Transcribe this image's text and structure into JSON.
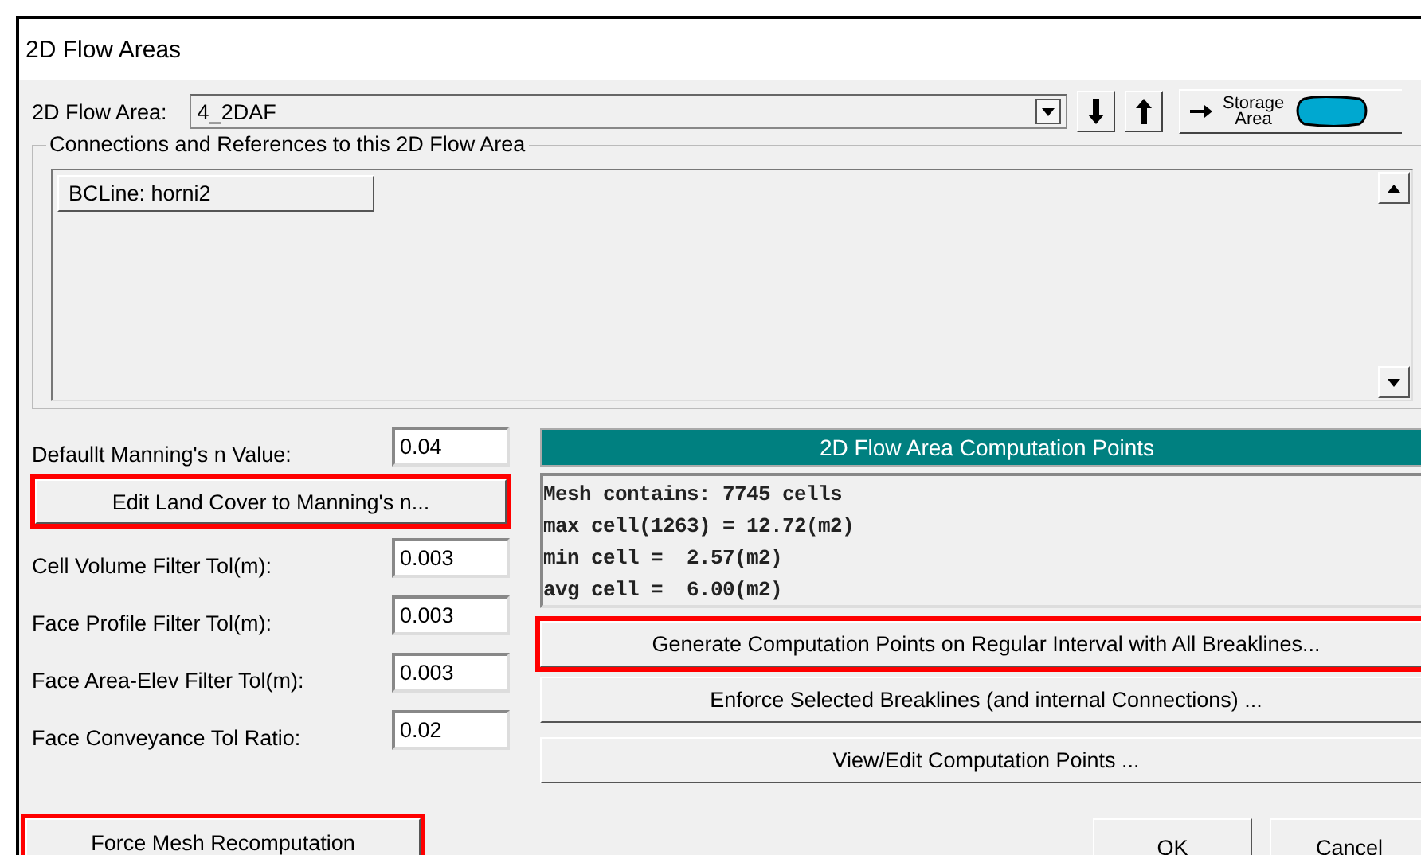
{
  "window": {
    "title": "2D Flow Areas"
  },
  "flow_area": {
    "label": "2D Flow Area:",
    "value": "4_2DAF",
    "storage_button": "Storage Area"
  },
  "connections": {
    "title": "Connections and References to this 2D Flow Area",
    "items": [
      {
        "label": "BCLine: horni2"
      }
    ]
  },
  "parameters": [
    {
      "kind": "field",
      "label": "Defaullt Manning's n Value:",
      "value": "0.04"
    },
    {
      "kind": "button",
      "label": "Edit Land Cover to Manning's n...",
      "highlighted": true
    },
    {
      "kind": "field",
      "label": "Cell Volume Filter Tol(m):",
      "value": "0.003"
    },
    {
      "kind": "field",
      "label": "Face Profile Filter Tol(m):",
      "value": "0.003"
    },
    {
      "kind": "field",
      "label": "Face Area-Elev Filter Tol(m):",
      "value": "0.003"
    },
    {
      "kind": "field",
      "label": "Face Conveyance Tol Ratio:",
      "value": "0.02"
    }
  ],
  "force_button": {
    "label": "Force Mesh Recomputation",
    "highlighted": true
  },
  "computation_points": {
    "title": "2D Flow Area Computation Points",
    "summary": [
      "Mesh contains: 7745 cells",
      "max cell(1263) = 12.72(m2)",
      "min cell =  2.57(m2)",
      "avg cell =  6.00(m2)"
    ],
    "buttons": [
      {
        "label": "Generate Computation Points on Regular Interval with All Breaklines...",
        "highlighted": true
      },
      {
        "label": "Enforce Selected Breaklines (and internal Connections) ...",
        "highlighted": false
      },
      {
        "label": "View/Edit Computation Points ...",
        "highlighted": false
      }
    ]
  },
  "dialog_buttons": [
    {
      "label": "OK"
    },
    {
      "label": "Cancel"
    }
  ]
}
